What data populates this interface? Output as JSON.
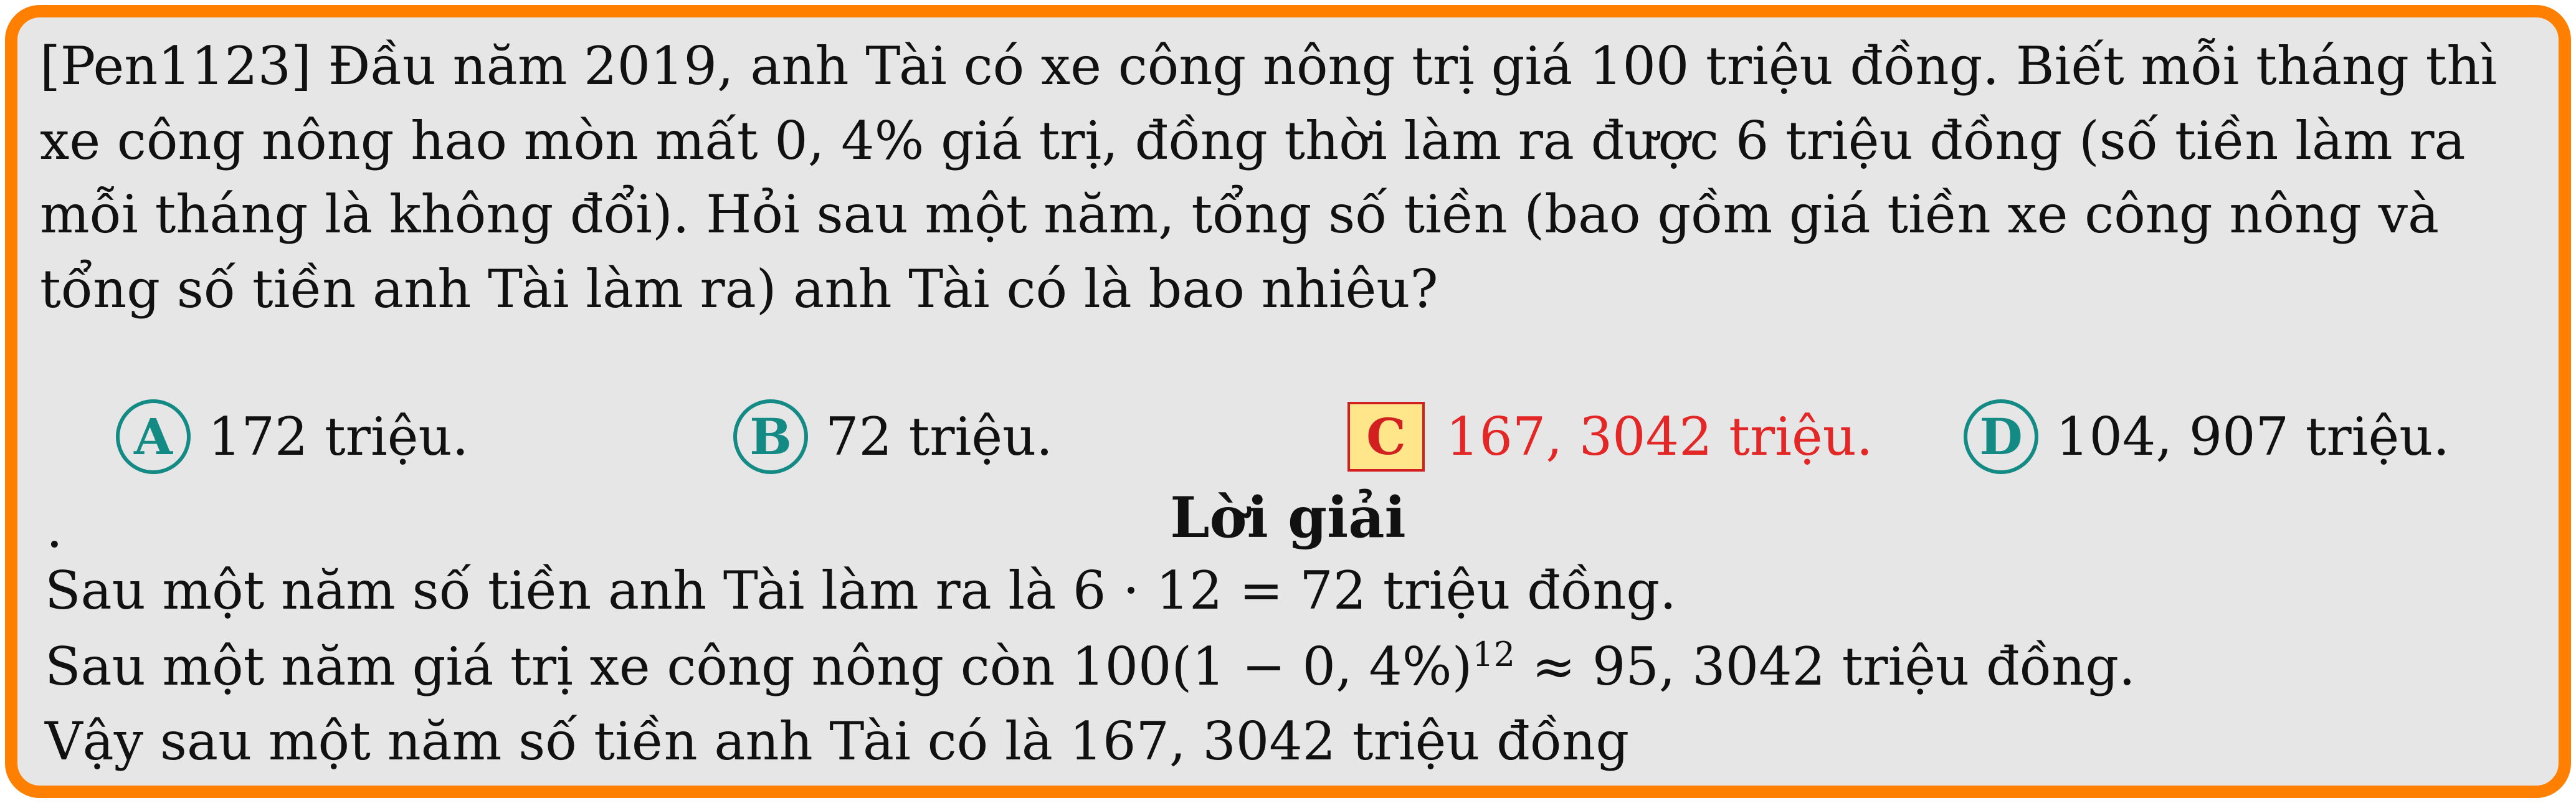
{
  "question": {
    "lines": [
      "[Pen1123] Đầu năm 2019, anh Tài có xe công nông trị giá 100 triệu đồng. Biết mỗi tháng thì",
      "xe công nông hao mòn mất 0, 4% giá trị, đồng thời làm ra được 6 triệu đồng (số tiền làm ra",
      "mỗi tháng là không đổi). Hỏi sau một năm, tổng số tiền (bao gồm giá tiền xe công nông và",
      "tổng số tiền anh Tài làm ra) anh Tài có là bao nhiêu?"
    ]
  },
  "choices": [
    {
      "letter": "A",
      "text": "172 triệu.",
      "correct": false
    },
    {
      "letter": "B",
      "text": "72 triệu.",
      "correct": false
    },
    {
      "letter": "C",
      "text": "167, 3042 triệu.",
      "correct": true
    },
    {
      "letter": "D",
      "text": "104, 907 triệu.",
      "correct": false
    }
  ],
  "solution": {
    "dot": ".",
    "title": "Lời giải",
    "line1": "Sau một năm số tiền anh Tài làm ra là 6 · 12 = 72 triệu đồng.",
    "line2_before": "Sau một năm giá trị xe công nông còn 100(1 − 0, 4%)",
    "line2_exp": "12",
    "line2_after": " ≈ 95, 3042 triệu đồng.",
    "line3": "Vậy sau một năm số tiền anh Tài có là 167, 3042 triệu đồng"
  },
  "colors": {
    "border": "#ff8000",
    "background": "#e6e6e6",
    "choice_circle": "#138a84",
    "correct_text": "#e32626",
    "correct_box": "#ffe68a"
  }
}
